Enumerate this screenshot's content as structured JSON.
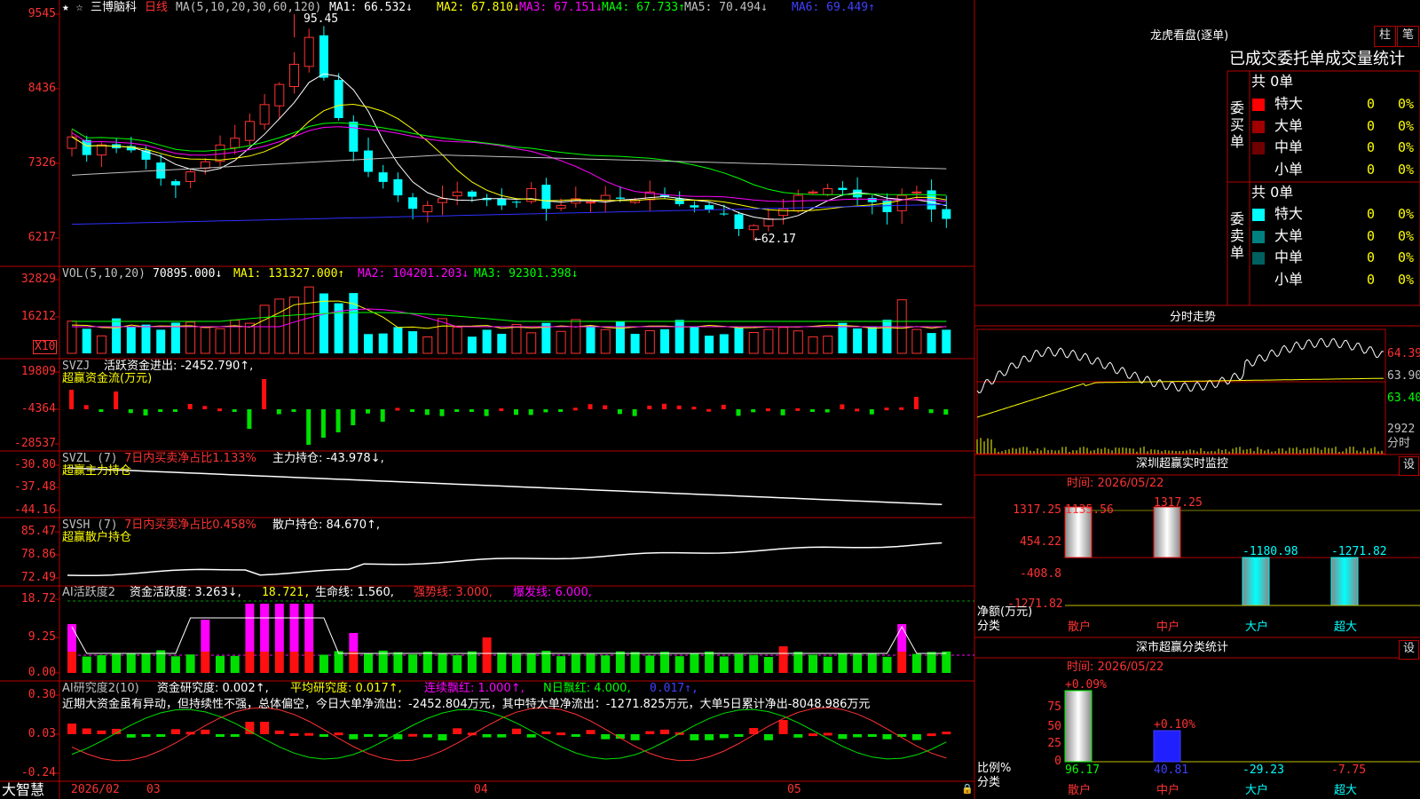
{
  "main": {
    "stock_name": "三博脑科",
    "period": "日线",
    "ma_header": "MA(5,10,20,30,60,120)",
    "ma": [
      {
        "label": "MA1: 66.532↓",
        "color": "#ffffff"
      },
      {
        "label": "MA2: 67.810↓",
        "color": "#ffff00"
      },
      {
        "label": "MA3: 67.151↓",
        "color": "#ff00ff"
      },
      {
        "label": "MA4: 67.733↑",
        "color": "#00ff00"
      },
      {
        "label": "MA5: 70.494↓",
        "color": "#c0c0c0"
      },
      {
        "label": "MA6: 69.449↑",
        "color": "#4040ff"
      }
    ],
    "axis": [
      "9545",
      "8436",
      "7326",
      "6217"
    ],
    "high_label": "95.45",
    "low_label": "←62.17"
  },
  "vol": {
    "header": "VOL(5,10,20)",
    "value": "70895.000↓",
    "ma": [
      {
        "label": "MA1: 131327.000↑",
        "color": "#ffff00"
      },
      {
        "label": "MA2: 104201.203↓",
        "color": "#ff00ff"
      },
      {
        "label": "MA3: 92301.398↓",
        "color": "#00ff00"
      }
    ],
    "axis": [
      "32829",
      "16212"
    ],
    "unit": "X10"
  },
  "svzj": {
    "header": "SVZJ",
    "value": "活跃资金进出: -2452.790↑,",
    "title": "超赢资金流(万元)",
    "axis": [
      "19809",
      "-4364",
      "-28537"
    ]
  },
  "svzl": {
    "header": "SVZL (7)",
    "desc": "7日内买卖净占比1.133%",
    "value": "主力持仓: -43.978↓,",
    "title": "超赢主力持仓",
    "axis": [
      "-30.80",
      "-37.48",
      "-44.16"
    ]
  },
  "svsh": {
    "header": "SVSH (7)",
    "desc": "7日内买卖净占比0.458%",
    "value": "散户持仓: 84.670↑,",
    "title": "超赢散户持仓",
    "axis": [
      "85.47",
      "78.86",
      "72.49"
    ]
  },
  "ai1": {
    "header": "AI活跃度2",
    "v1": "资金活跃度: 3.263↓,",
    "v2": "18.721,",
    "v3": "生命线: 1.560,",
    "v4": "强势线: 3.000,",
    "v5": "爆发线: 6.000,",
    "axis": [
      "18.72",
      "9.25",
      "0.00"
    ]
  },
  "ai2": {
    "header": "AI研究度2(10)",
    "v1": "资金研究度: 0.002↑,",
    "v2": "平均研究度: 0.017↑,",
    "v3": "连续飘红: 1.000↑,",
    "v4": "N日飘红: 4.000,",
    "v5": "0.017↑,",
    "comment": "近期大资金虽有异动，但持续性不强，总体偏空，今日大单净流出：-2452.804万元，其中特大单净流出：-1271.825万元，大单5日累计净出-8048.986万元",
    "axis": [
      "0.30",
      "0.03",
      "-0.24"
    ]
  },
  "bottom": {
    "brand": "大智慧",
    "dates": [
      "2026/02",
      "03",
      "04",
      "05"
    ]
  },
  "lhb": {
    "title": "龙虎看盘(逐单)",
    "btn1": "柱",
    "btn2": "笔",
    "subtitle": "已成交委托单成交量统计",
    "buy": {
      "side": "委买单",
      "total": "共 0单",
      "rows": [
        {
          "name": "特大",
          "count": "0",
          "pct": "0%",
          "color": "#ff0000"
        },
        {
          "name": "大单",
          "count": "0",
          "pct": "0%",
          "color": "#a00000"
        },
        {
          "name": "中单",
          "count": "0",
          "pct": "0%",
          "color": "#700000"
        },
        {
          "name": "小单",
          "count": "0",
          "pct": "0%",
          "color": "#000000"
        }
      ]
    },
    "sell": {
      "side": "委卖单",
      "total": "共 0单",
      "rows": [
        {
          "name": "特大",
          "count": "0",
          "pct": "0%",
          "color": "#00ffff"
        },
        {
          "name": "大单",
          "count": "0",
          "pct": "0%",
          "color": "#008080"
        },
        {
          "name": "中单",
          "count": "0",
          "pct": "0%",
          "color": "#006060"
        },
        {
          "name": "小单",
          "count": "0",
          "pct": "0%",
          "color": "#000000"
        }
      ]
    }
  },
  "intraday": {
    "title": "分时走势",
    "axis": [
      "64.39",
      "63.90",
      "63.40",
      "2922"
    ],
    "unit": "分时"
  },
  "sz_monitor": {
    "title": "深圳超赢实时监控",
    "set": "设",
    "time": "时间: 2026/05/22",
    "axis": [
      "1317.25",
      "454.22",
      "-408.8",
      "-1271.82"
    ],
    "ylabel": "净额(万元)",
    "xlabel": "分类",
    "categories": [
      "散户",
      "中户",
      "大户",
      "超大"
    ],
    "value_labels": [
      "1135.56",
      "1317.25",
      "-1180.98",
      "-1271.82"
    ]
  },
  "sz_class": {
    "title": "深市超赢分类统计",
    "set": "设",
    "time": "时间: 2026/05/22",
    "axis": [
      "75",
      "50",
      "25",
      "0"
    ],
    "ylabel": "比例%",
    "xlabel": "分类",
    "categories": [
      "散户",
      "中户",
      "大户",
      "超大"
    ],
    "pct_labels": [
      "+0.09%",
      "+0.10%"
    ],
    "values": [
      "96.17",
      "40.81",
      "-29.23",
      "-7.75"
    ]
  },
  "chart_data": [
    {
      "type": "bar",
      "title": "深圳超赢实时监控",
      "categories": [
        "散户",
        "中户",
        "大户",
        "超大"
      ],
      "values": [
        1135.56,
        1317.25,
        -1180.98,
        -1271.82
      ],
      "ylabel": "净额(万元)",
      "xlabel": "分类",
      "ylim": [
        -1271.82,
        1317.25
      ]
    },
    {
      "type": "bar",
      "title": "深市超赢分类统计",
      "categories": [
        "散户",
        "中户",
        "大户",
        "超大"
      ],
      "values": [
        96.17,
        40.81,
        -29.23,
        -7.75
      ],
      "ylabel": "比例%",
      "xlabel": "分类",
      "ylim": [
        0,
        100
      ]
    },
    {
      "type": "line",
      "title": "三博脑科 日线",
      "series": [
        {
          "name": "close",
          "values": [
            77.2,
            74.5,
            76.0,
            75.5,
            75.2,
            73.8,
            71.0,
            70.0,
            72.0,
            73.5,
            76.0,
            77.0,
            79.5,
            82.0,
            85.0,
            88.0,
            92.0,
            86.0,
            80.0,
            75.0,
            72.0,
            70.5,
            68.5,
            66.5,
            67.0,
            68.0,
            69.0,
            68.3,
            67.8,
            67.0,
            67.5,
            69.5,
            66.5,
            67.0,
            68.0,
            67.5,
            68.5,
            68.0,
            67.8,
            69.0,
            68.3,
            67.2,
            66.7,
            66.4,
            65.8,
            63.5,
            64.0,
            65.0,
            66.5,
            68.5,
            69.0,
            69.5,
            69.3,
            68.2,
            67.5,
            66.0,
            68.5,
            69.0,
            66.4,
            65.0
          ]
        }
      ]
    }
  ]
}
